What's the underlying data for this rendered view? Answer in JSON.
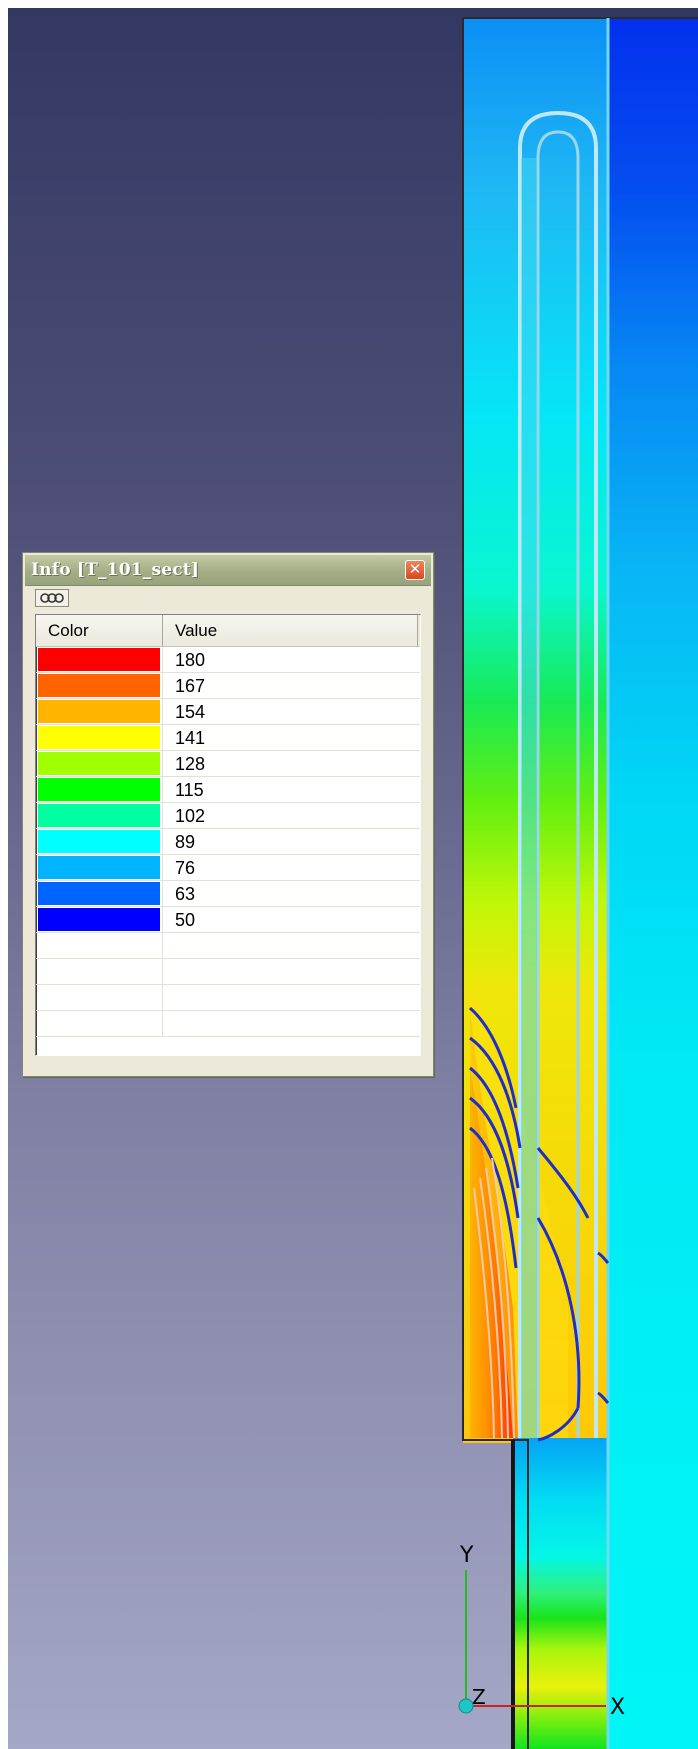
{
  "window": {
    "title": "Info [T_101_sect]",
    "close_glyph": "✕",
    "toolbar_icon": "chain-link-icon"
  },
  "table": {
    "headers": [
      "Color",
      "Value"
    ],
    "rows": [
      {
        "color": "#ff0000",
        "value": "180"
      },
      {
        "color": "#ff6400",
        "value": "167"
      },
      {
        "color": "#ffb400",
        "value": "154"
      },
      {
        "color": "#ffff00",
        "value": "141"
      },
      {
        "color": "#a0ff00",
        "value": "128"
      },
      {
        "color": "#00ff00",
        "value": "115"
      },
      {
        "color": "#00ffa0",
        "value": "102"
      },
      {
        "color": "#00ffff",
        "value": "89"
      },
      {
        "color": "#00b4ff",
        "value": "76"
      },
      {
        "color": "#0064ff",
        "value": "63"
      },
      {
        "color": "#0000ff",
        "value": "50"
      }
    ],
    "empty_rows": 4
  },
  "axes": {
    "y_label": "Y",
    "x_label": "X",
    "z_label": "Z"
  }
}
